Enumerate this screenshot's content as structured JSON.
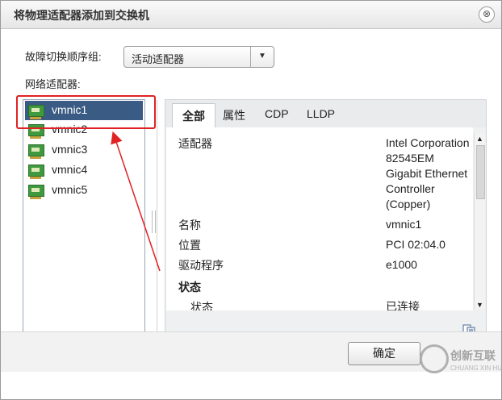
{
  "dialog": {
    "title": "将物理适配器添加到交换机",
    "close_glyph": "⊗"
  },
  "failover": {
    "label": "故障切换顺序组:",
    "selected": "活动适配器",
    "arrow_glyph": "▼"
  },
  "adapters": {
    "label": "网络适配器:",
    "items": [
      {
        "name": "vmnic1",
        "selected": true
      },
      {
        "name": "vmnic2",
        "selected": false
      },
      {
        "name": "vmnic3",
        "selected": false
      },
      {
        "name": "vmnic4",
        "selected": false
      },
      {
        "name": "vmnic5",
        "selected": false
      }
    ]
  },
  "tabs": [
    "全部",
    "属性",
    "CDP",
    "LLDP"
  ],
  "details": {
    "adapter_label": "适配器",
    "adapter_value_lines": [
      "Intel Corporation",
      "82545EM",
      "Gigabit Ethernet",
      "Controller",
      "(Copper)"
    ],
    "name_label": "名称",
    "name_value": "vmnic1",
    "location_label": "位置",
    "location_value": "PCI 02:04.0",
    "driver_label": "驱动程序",
    "driver_value": "e1000",
    "status_heading": "状态",
    "status_label": "状态",
    "status_value": "已连接"
  },
  "footer": {
    "ok_label": "确定"
  },
  "watermark": {
    "brand": "创新互联",
    "sub": "CHUANG XIN HU LIAN"
  },
  "colors": {
    "selection": "#3a5b84",
    "annotation": "#e02222"
  }
}
